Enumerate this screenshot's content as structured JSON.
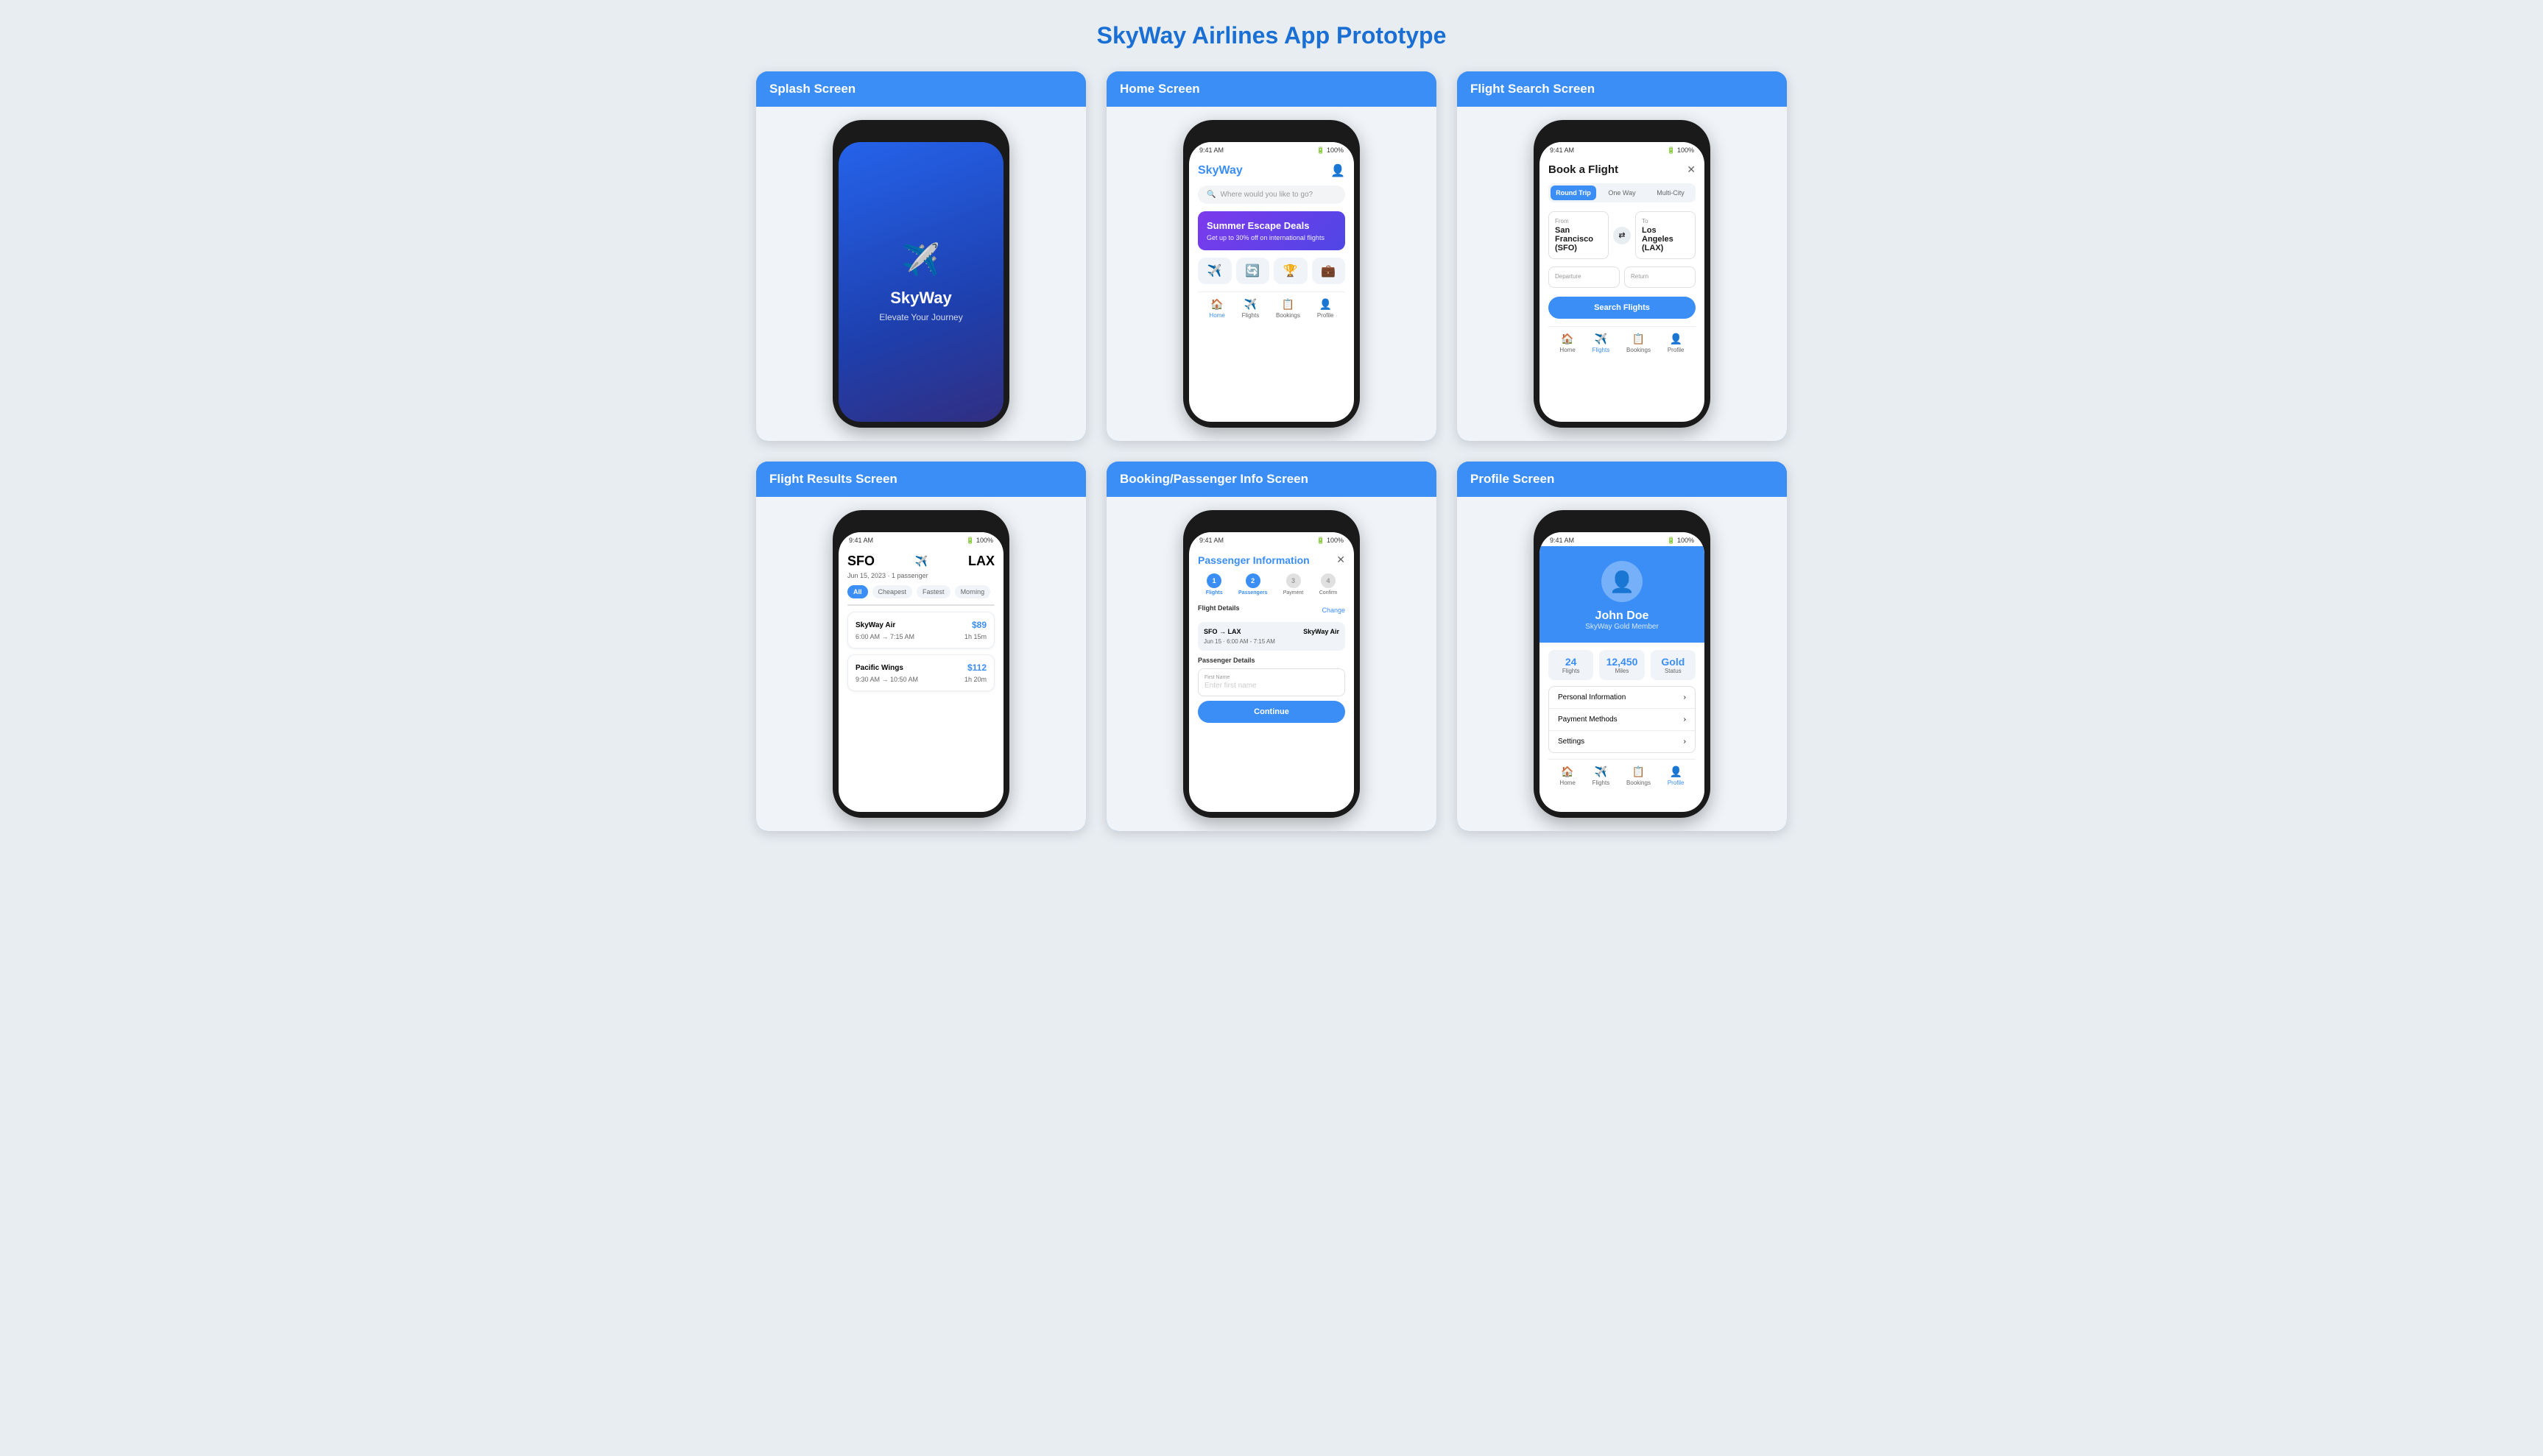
{
  "page": {
    "title": "SkyWay Airlines App Prototype"
  },
  "screens": [
    {
      "id": "splash",
      "header": "Splash Screen",
      "icon": "✈️",
      "app_name": "SkyWay",
      "tagline": "Elevate Your Journey"
    },
    {
      "id": "home",
      "header": "Home Screen",
      "status_time": "9:41 AM",
      "status_battery": "🔋 100%",
      "logo": "SkyWay",
      "search_placeholder": "Where would you like to go?",
      "promo_title": "Summer Escape Deals",
      "promo_sub": "Get up to 30% off on international flights",
      "quick_links": [
        "✈️",
        "🔄",
        "🏆",
        "💼"
      ],
      "nav": [
        {
          "label": "Home",
          "icon": "🏠",
          "active": true
        },
        {
          "label": "Flights",
          "icon": "✈️",
          "active": false
        },
        {
          "label": "Bookings",
          "icon": "📋",
          "active": false
        },
        {
          "label": "Profile",
          "icon": "👤",
          "active": false
        }
      ]
    },
    {
      "id": "flight-search",
      "header": "Flight Search Screen",
      "status_time": "9:41 AM",
      "status_battery": "🔋 100%",
      "modal_title": "Book a Flight",
      "tabs": [
        {
          "label": "Round Trip",
          "active": true
        },
        {
          "label": "One Way",
          "active": false
        },
        {
          "label": "Multi-City",
          "active": false
        }
      ],
      "from_label": "From",
      "to_label": "To",
      "from_airport": "San Francisco (SFO)",
      "to_airport": "Los Angeles (LAX)",
      "departure_label": "Departure",
      "return_label": "Return",
      "nav": [
        {
          "label": "Home",
          "icon": "🏠"
        },
        {
          "label": "Flights",
          "icon": "✈️"
        },
        {
          "label": "Bookings",
          "icon": "📋"
        },
        {
          "label": "Profile",
          "icon": "👤"
        }
      ]
    },
    {
      "id": "flight-results",
      "header": "Flight Results Screen",
      "status_time": "9:41 AM",
      "status_battery": "🔋 100%",
      "route_from": "SFO",
      "route_to": "LAX",
      "route_sub": "Jun 15, 2023 · 1 passenger",
      "filters": [
        {
          "label": "All",
          "active": true
        },
        {
          "label": "Cheapest",
          "active": false
        },
        {
          "label": "Fastest",
          "active": false
        },
        {
          "label": "Morning",
          "active": false
        }
      ]
    },
    {
      "id": "booking",
      "header": "Booking/Passenger Info Screen",
      "status_time": "9:41 AM",
      "status_battery": "🔋 100%",
      "title": "Passenger Information",
      "steps": [
        {
          "num": "1",
          "label": "Flights",
          "status": "done"
        },
        {
          "num": "2",
          "label": "Passengers",
          "status": "current"
        },
        {
          "num": "3",
          "label": "Payment",
          "status": "pending"
        },
        {
          "num": "4",
          "label": "Confirm",
          "status": "pending"
        }
      ],
      "section_label": "Flight Details",
      "change_label": "Change"
    },
    {
      "id": "profile",
      "header": "Profile Screen",
      "status_time": "9:41 AM",
      "status_battery": "🔋 100%",
      "name": "John Doe",
      "member_status": "SkyWay Gold Member",
      "stats": [
        {
          "val": "24",
          "label": "Flights"
        },
        {
          "val": "12,450",
          "label": "Miles"
        },
        {
          "val": "Gold",
          "label": "Status"
        }
      ],
      "nav": [
        {
          "label": "Home",
          "icon": "🏠"
        },
        {
          "label": "Flights",
          "icon": "✈️"
        },
        {
          "label": "Bookings",
          "icon": "📋"
        },
        {
          "label": "Profile",
          "icon": "👤",
          "active": true
        }
      ]
    }
  ]
}
